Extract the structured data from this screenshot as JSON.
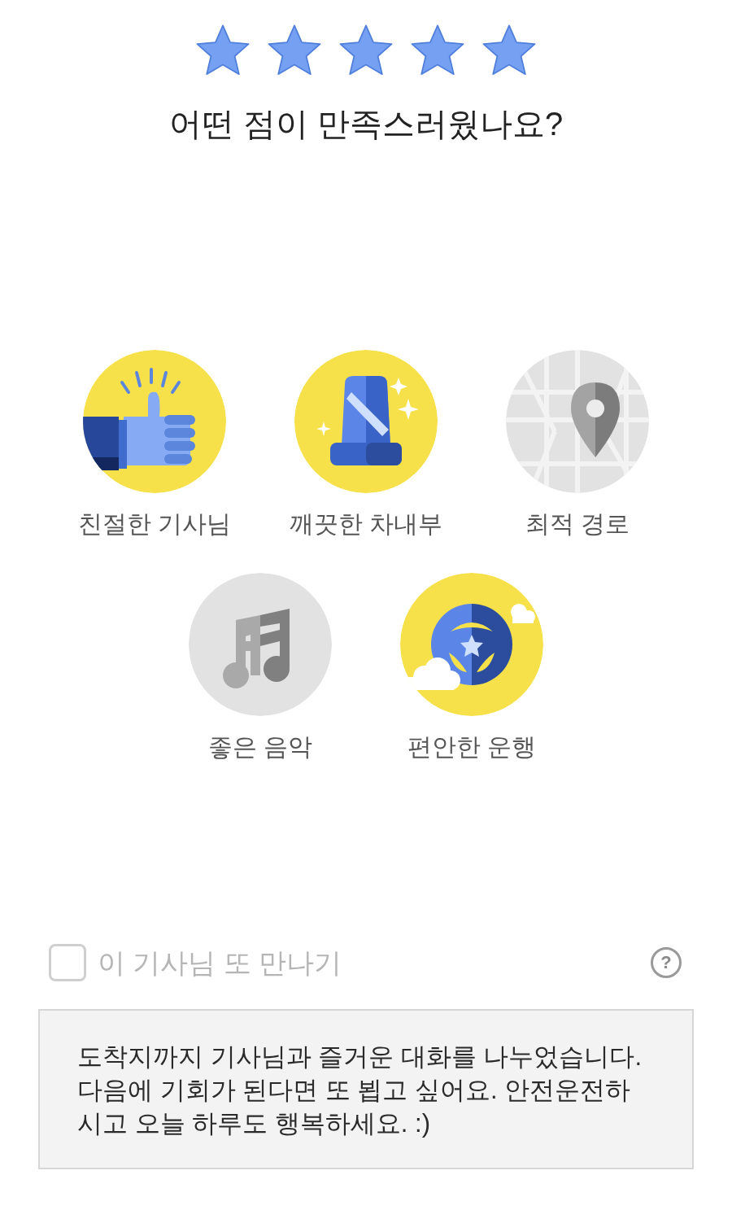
{
  "rating": {
    "stars": 5
  },
  "title": "어떤 점이 만족스러웠나요?",
  "options": [
    {
      "label": "친절한 기사님",
      "kind": "thumb",
      "selected": true
    },
    {
      "label": "깨끗한 차내부",
      "kind": "seat",
      "selected": true
    },
    {
      "label": "최적 경로",
      "kind": "map",
      "selected": false
    },
    {
      "label": "좋은 음악",
      "kind": "music",
      "selected": false
    },
    {
      "label": "편안한 운행",
      "kind": "wheel",
      "selected": true
    }
  ],
  "meet_again": {
    "label": "이 기사님 또 만나기",
    "checked": false
  },
  "help": "?",
  "comment": {
    "value": "도착지까지 기사님과 즐거운 대화를 나누었습니다. 다음에 기회가 된다면 또 뵙고 싶어요. 안전운전하시고 오늘 하루도 행복하세요. :)"
  }
}
